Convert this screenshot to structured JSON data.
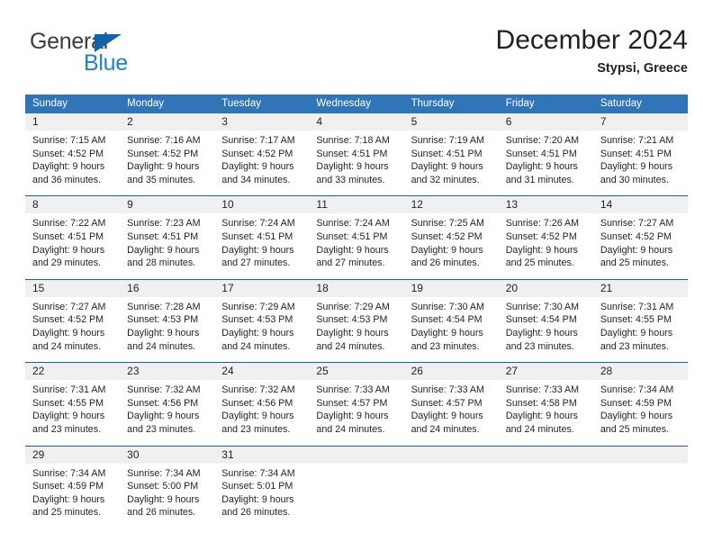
{
  "brand": {
    "name_top": "General",
    "name_bottom": "Blue",
    "triangle_color": "#1362ac",
    "blue_color": "#1f7fd0"
  },
  "header": {
    "title": "December 2024",
    "subtitle": "Stypsi, Greece"
  },
  "colors": {
    "header_blue": "#3075b8",
    "row_rule_blue": "#1c5fa0",
    "daynum_band": "#f0f0f0"
  },
  "weekdays": [
    "Sunday",
    "Monday",
    "Tuesday",
    "Wednesday",
    "Thursday",
    "Friday",
    "Saturday"
  ],
  "weeks": [
    [
      {
        "day": "1",
        "sunrise": "Sunrise: 7:15 AM",
        "sunset": "Sunset: 4:52 PM",
        "daylight1": "Daylight: 9 hours",
        "daylight2": "and 36 minutes."
      },
      {
        "day": "2",
        "sunrise": "Sunrise: 7:16 AM",
        "sunset": "Sunset: 4:52 PM",
        "daylight1": "Daylight: 9 hours",
        "daylight2": "and 35 minutes."
      },
      {
        "day": "3",
        "sunrise": "Sunrise: 7:17 AM",
        "sunset": "Sunset: 4:52 PM",
        "daylight1": "Daylight: 9 hours",
        "daylight2": "and 34 minutes."
      },
      {
        "day": "4",
        "sunrise": "Sunrise: 7:18 AM",
        "sunset": "Sunset: 4:51 PM",
        "daylight1": "Daylight: 9 hours",
        "daylight2": "and 33 minutes."
      },
      {
        "day": "5",
        "sunrise": "Sunrise: 7:19 AM",
        "sunset": "Sunset: 4:51 PM",
        "daylight1": "Daylight: 9 hours",
        "daylight2": "and 32 minutes."
      },
      {
        "day": "6",
        "sunrise": "Sunrise: 7:20 AM",
        "sunset": "Sunset: 4:51 PM",
        "daylight1": "Daylight: 9 hours",
        "daylight2": "and 31 minutes."
      },
      {
        "day": "7",
        "sunrise": "Sunrise: 7:21 AM",
        "sunset": "Sunset: 4:51 PM",
        "daylight1": "Daylight: 9 hours",
        "daylight2": "and 30 minutes."
      }
    ],
    [
      {
        "day": "8",
        "sunrise": "Sunrise: 7:22 AM",
        "sunset": "Sunset: 4:51 PM",
        "daylight1": "Daylight: 9 hours",
        "daylight2": "and 29 minutes."
      },
      {
        "day": "9",
        "sunrise": "Sunrise: 7:23 AM",
        "sunset": "Sunset: 4:51 PM",
        "daylight1": "Daylight: 9 hours",
        "daylight2": "and 28 minutes."
      },
      {
        "day": "10",
        "sunrise": "Sunrise: 7:24 AM",
        "sunset": "Sunset: 4:51 PM",
        "daylight1": "Daylight: 9 hours",
        "daylight2": "and 27 minutes."
      },
      {
        "day": "11",
        "sunrise": "Sunrise: 7:24 AM",
        "sunset": "Sunset: 4:51 PM",
        "daylight1": "Daylight: 9 hours",
        "daylight2": "and 27 minutes."
      },
      {
        "day": "12",
        "sunrise": "Sunrise: 7:25 AM",
        "sunset": "Sunset: 4:52 PM",
        "daylight1": "Daylight: 9 hours",
        "daylight2": "and 26 minutes."
      },
      {
        "day": "13",
        "sunrise": "Sunrise: 7:26 AM",
        "sunset": "Sunset: 4:52 PM",
        "daylight1": "Daylight: 9 hours",
        "daylight2": "and 25 minutes."
      },
      {
        "day": "14",
        "sunrise": "Sunrise: 7:27 AM",
        "sunset": "Sunset: 4:52 PM",
        "daylight1": "Daylight: 9 hours",
        "daylight2": "and 25 minutes."
      }
    ],
    [
      {
        "day": "15",
        "sunrise": "Sunrise: 7:27 AM",
        "sunset": "Sunset: 4:52 PM",
        "daylight1": "Daylight: 9 hours",
        "daylight2": "and 24 minutes."
      },
      {
        "day": "16",
        "sunrise": "Sunrise: 7:28 AM",
        "sunset": "Sunset: 4:53 PM",
        "daylight1": "Daylight: 9 hours",
        "daylight2": "and 24 minutes."
      },
      {
        "day": "17",
        "sunrise": "Sunrise: 7:29 AM",
        "sunset": "Sunset: 4:53 PM",
        "daylight1": "Daylight: 9 hours",
        "daylight2": "and 24 minutes."
      },
      {
        "day": "18",
        "sunrise": "Sunrise: 7:29 AM",
        "sunset": "Sunset: 4:53 PM",
        "daylight1": "Daylight: 9 hours",
        "daylight2": "and 24 minutes."
      },
      {
        "day": "19",
        "sunrise": "Sunrise: 7:30 AM",
        "sunset": "Sunset: 4:54 PM",
        "daylight1": "Daylight: 9 hours",
        "daylight2": "and 23 minutes."
      },
      {
        "day": "20",
        "sunrise": "Sunrise: 7:30 AM",
        "sunset": "Sunset: 4:54 PM",
        "daylight1": "Daylight: 9 hours",
        "daylight2": "and 23 minutes."
      },
      {
        "day": "21",
        "sunrise": "Sunrise: 7:31 AM",
        "sunset": "Sunset: 4:55 PM",
        "daylight1": "Daylight: 9 hours",
        "daylight2": "and 23 minutes."
      }
    ],
    [
      {
        "day": "22",
        "sunrise": "Sunrise: 7:31 AM",
        "sunset": "Sunset: 4:55 PM",
        "daylight1": "Daylight: 9 hours",
        "daylight2": "and 23 minutes."
      },
      {
        "day": "23",
        "sunrise": "Sunrise: 7:32 AM",
        "sunset": "Sunset: 4:56 PM",
        "daylight1": "Daylight: 9 hours",
        "daylight2": "and 23 minutes."
      },
      {
        "day": "24",
        "sunrise": "Sunrise: 7:32 AM",
        "sunset": "Sunset: 4:56 PM",
        "daylight1": "Daylight: 9 hours",
        "daylight2": "and 23 minutes."
      },
      {
        "day": "25",
        "sunrise": "Sunrise: 7:33 AM",
        "sunset": "Sunset: 4:57 PM",
        "daylight1": "Daylight: 9 hours",
        "daylight2": "and 24 minutes."
      },
      {
        "day": "26",
        "sunrise": "Sunrise: 7:33 AM",
        "sunset": "Sunset: 4:57 PM",
        "daylight1": "Daylight: 9 hours",
        "daylight2": "and 24 minutes."
      },
      {
        "day": "27",
        "sunrise": "Sunrise: 7:33 AM",
        "sunset": "Sunset: 4:58 PM",
        "daylight1": "Daylight: 9 hours",
        "daylight2": "and 24 minutes."
      },
      {
        "day": "28",
        "sunrise": "Sunrise: 7:34 AM",
        "sunset": "Sunset: 4:59 PM",
        "daylight1": "Daylight: 9 hours",
        "daylight2": "and 25 minutes."
      }
    ],
    [
      {
        "day": "29",
        "sunrise": "Sunrise: 7:34 AM",
        "sunset": "Sunset: 4:59 PM",
        "daylight1": "Daylight: 9 hours",
        "daylight2": "and 25 minutes."
      },
      {
        "day": "30",
        "sunrise": "Sunrise: 7:34 AM",
        "sunset": "Sunset: 5:00 PM",
        "daylight1": "Daylight: 9 hours",
        "daylight2": "and 26 minutes."
      },
      {
        "day": "31",
        "sunrise": "Sunrise: 7:34 AM",
        "sunset": "Sunset: 5:01 PM",
        "daylight1": "Daylight: 9 hours",
        "daylight2": "and 26 minutes."
      },
      {
        "day": "",
        "sunrise": "",
        "sunset": "",
        "daylight1": "",
        "daylight2": ""
      },
      {
        "day": "",
        "sunrise": "",
        "sunset": "",
        "daylight1": "",
        "daylight2": ""
      },
      {
        "day": "",
        "sunrise": "",
        "sunset": "",
        "daylight1": "",
        "daylight2": ""
      },
      {
        "day": "",
        "sunrise": "",
        "sunset": "",
        "daylight1": "",
        "daylight2": ""
      }
    ]
  ]
}
